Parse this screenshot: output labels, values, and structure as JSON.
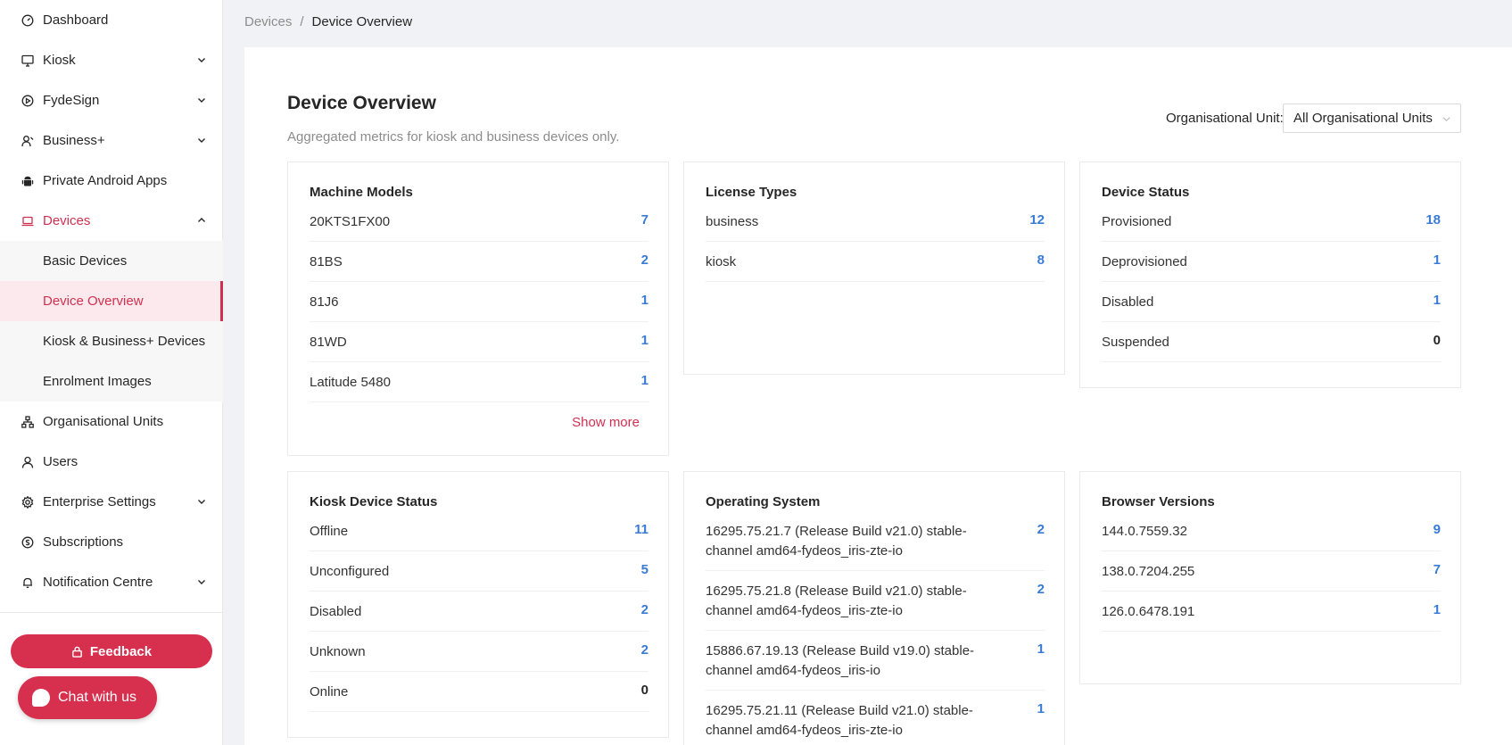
{
  "sidebar": {
    "items": [
      {
        "label": "Dashboard",
        "icon": "dashboard-icon"
      },
      {
        "label": "Kiosk",
        "icon": "kiosk-icon",
        "expandable": true
      },
      {
        "label": "FydeSign",
        "icon": "fydesign-icon",
        "expandable": true
      },
      {
        "label": "Business+",
        "icon": "business-icon",
        "expandable": true
      },
      {
        "label": "Private Android Apps",
        "icon": "android-icon"
      },
      {
        "label": "Devices",
        "icon": "laptop-icon",
        "expanded": true
      },
      {
        "label": "Basic Devices"
      },
      {
        "label": "Device Overview",
        "active": true
      },
      {
        "label": "Kiosk & Business+ Devices"
      },
      {
        "label": "Enrolment Images"
      },
      {
        "label": "Organisational Units",
        "icon": "org-units-icon"
      },
      {
        "label": "Users",
        "icon": "user-icon"
      },
      {
        "label": "Enterprise Settings",
        "icon": "gear-icon",
        "expandable": true
      },
      {
        "label": "Subscriptions",
        "icon": "subscriptions-icon"
      },
      {
        "label": "Notification Centre",
        "icon": "bell-icon",
        "expandable": true
      }
    ],
    "feedback_label": "Feedback",
    "chat_label": "Chat with us"
  },
  "breadcrumb": {
    "parent": "Devices",
    "separator": "/",
    "current": "Device Overview"
  },
  "page": {
    "title": "Device Overview",
    "subtitle": "Aggregated metrics for kiosk and business devices only.",
    "ou_label": "Organisational Unit:",
    "ou_value": "All Organisational Units"
  },
  "cards": {
    "machine_models": {
      "title": "Machine Models",
      "rows": [
        {
          "label": "20KTS1FX00",
          "value": "7"
        },
        {
          "label": "81BS",
          "value": "2"
        },
        {
          "label": "81J6",
          "value": "1"
        },
        {
          "label": "81WD",
          "value": "1"
        },
        {
          "label": "Latitude 5480",
          "value": "1"
        }
      ],
      "show_more": "Show more"
    },
    "license_types": {
      "title": "License Types",
      "rows": [
        {
          "label": "business",
          "value": "12"
        },
        {
          "label": "kiosk",
          "value": "8"
        }
      ]
    },
    "device_status": {
      "title": "Device Status",
      "rows": [
        {
          "label": "Provisioned",
          "value": "18"
        },
        {
          "label": "Deprovisioned",
          "value": "1"
        },
        {
          "label": "Disabled",
          "value": "1"
        },
        {
          "label": "Suspended",
          "value": "0"
        }
      ]
    },
    "kiosk_device_status": {
      "title": "Kiosk Device Status",
      "rows": [
        {
          "label": "Offline",
          "value": "11"
        },
        {
          "label": "Unconfigured",
          "value": "5"
        },
        {
          "label": "Disabled",
          "value": "2"
        },
        {
          "label": "Unknown",
          "value": "2"
        },
        {
          "label": "Online",
          "value": "0"
        }
      ]
    },
    "operating_system": {
      "title": "Operating System",
      "rows": [
        {
          "label": "16295.75.21.7 (Release Build v21.0) stable-channel amd64-fydeos_iris-zte-io",
          "value": "2"
        },
        {
          "label": "16295.75.21.8 (Release Build v21.0) stable-channel amd64-fydeos_iris-zte-io",
          "value": "2"
        },
        {
          "label": "15886.67.19.13 (Release Build v19.0) stable-channel amd64-fydeos_iris-io",
          "value": "1"
        },
        {
          "label": "16295.75.21.11 (Release Build v21.0) stable-channel amd64-fydeos_iris-zte-io",
          "value": "1"
        }
      ]
    },
    "browser_versions": {
      "title": "Browser Versions",
      "rows": [
        {
          "label": "144.0.7559.32",
          "value": "9"
        },
        {
          "label": "138.0.7204.255",
          "value": "7"
        },
        {
          "label": "126.0.6478.191",
          "value": "1"
        }
      ]
    }
  },
  "colors": {
    "accent": "#d03050",
    "value_blue": "#3a7bd5",
    "background": "#f0f2f5"
  }
}
